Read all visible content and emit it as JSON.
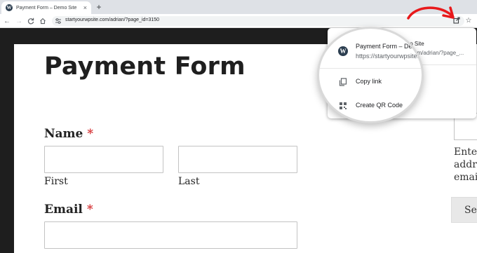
{
  "browser": {
    "tab_title": "Payment Form – Demo Site",
    "tab_close": "×",
    "new_tab": "+",
    "url": "startyourwpsite.com/adrian/?page_id=3150",
    "nav": {
      "back": "←",
      "forward": "→",
      "reload": "C",
      "home": "⌂"
    },
    "star": "☆"
  },
  "share_menu": {
    "page_title": "Payment Form – Demo Site",
    "page_url": "https://startyourwpsite.com/adrian/?page_...",
    "items": [
      {
        "label": "Copy link",
        "icon": "copy-icon"
      },
      {
        "label": "Create QR Code",
        "icon": "qr-code-icon"
      }
    ]
  },
  "form": {
    "title": "Payment Form",
    "name_label": "Name",
    "required_mark": "*",
    "first_label": "First",
    "last_label": "Last",
    "email_label": "Email"
  },
  "sidebar": {
    "lines": [
      "Enter",
      "addre",
      "emai"
    ],
    "button_label": "Se"
  },
  "colors": {
    "annotation_arrow": "#e8191b",
    "required": "#d63638"
  }
}
